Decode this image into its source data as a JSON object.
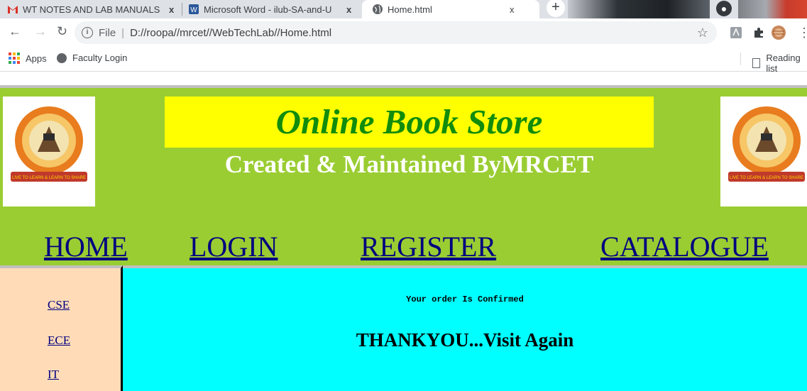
{
  "browser": {
    "tabs": [
      {
        "title": "WT NOTES AND LAB MANUALS",
        "icon": "gmail-icon"
      },
      {
        "title": "Microsoft Word - ilub-SA-and-U",
        "icon": "word-online-icon"
      },
      {
        "title": "Home.html",
        "icon": "globe-icon"
      }
    ],
    "close_glyph": "x",
    "new_tab_glyph": "+",
    "address": {
      "scheme_label": "File",
      "url": "D://roopa//mrcet//WebTechLab//Home.html"
    },
    "bookmarks": [
      {
        "label": "Apps",
        "icon": "apps-grid-icon"
      },
      {
        "label": "Faculty Login",
        "icon": "globe-icon"
      }
    ],
    "reading_list": "Reading list"
  },
  "page": {
    "colors": {
      "header_bg": "#9acd32",
      "banner_bg": "#ffff00",
      "title": "#118c0c",
      "sidebar_bg": "#ffdcb7",
      "content_bg": "#00ffff",
      "link": "#000080"
    },
    "logo_motto": "LIVE TO LEARN & LEARN TO SHARE",
    "title": "Online Book Store",
    "subtitle": "Created & Maintained ByMRCET",
    "nav": [
      "HOME",
      "LOGIN",
      "REGISTER",
      "CATALOGUE"
    ],
    "sidebar": [
      "CSE",
      "ECE",
      "IT"
    ],
    "confirm_message": "Your order Is Confirmed",
    "thanks_message": "THANKYOU...Visit Again"
  }
}
